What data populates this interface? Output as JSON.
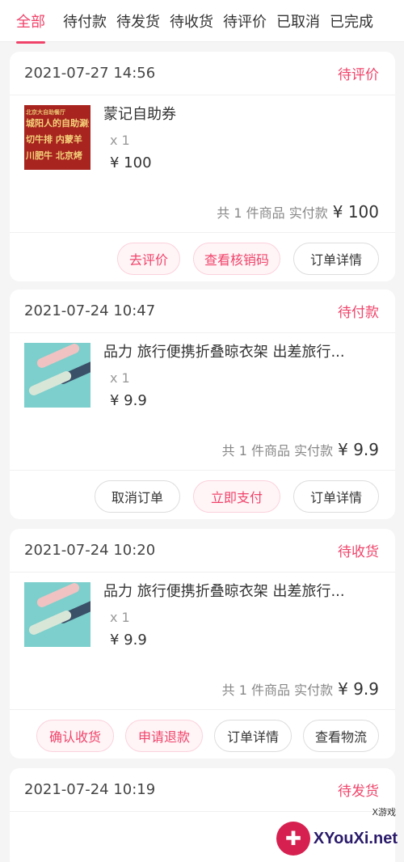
{
  "tabs": [
    {
      "label": "全部",
      "active": true
    },
    {
      "label": "待付款"
    },
    {
      "label": "待发货"
    },
    {
      "label": "待收货"
    },
    {
      "label": "待评价"
    },
    {
      "label": "已取消"
    },
    {
      "label": "已完成"
    }
  ],
  "orders": [
    {
      "time": "2021-07-27 14:56",
      "status": "待评价",
      "item": {
        "name": "蒙记自助券",
        "qty": "x 1",
        "price": "¥ 100",
        "thumb_lines": [
          "北京大自助餐厅",
          "城阳人的自助涮烤",
          "切牛排 内蒙羊",
          "川肥牛 北京烤"
        ]
      },
      "summary_label": "共 1 件商品 实付款",
      "total": "¥ 100",
      "buttons": [
        {
          "label": "去评价",
          "style": "pink"
        },
        {
          "label": "查看核销码",
          "style": "pink"
        },
        {
          "label": "订单详情",
          "style": "plain"
        }
      ]
    },
    {
      "time": "2021-07-24 10:47",
      "status": "待付款",
      "item": {
        "name": "品力 旅行便携折叠晾衣架 出差旅行...",
        "qty": "x 1",
        "price": "¥ 9.9"
      },
      "summary_label": "共 1 件商品 实付款",
      "total": "¥ 9.9",
      "buttons": [
        {
          "label": "取消订单",
          "style": "plain"
        },
        {
          "label": "立即支付",
          "style": "pink"
        },
        {
          "label": "订单详情",
          "style": "plain"
        }
      ]
    },
    {
      "time": "2021-07-24 10:20",
      "status": "待收货",
      "item": {
        "name": "品力 旅行便携折叠晾衣架 出差旅行...",
        "qty": "x 1",
        "price": "¥ 9.9"
      },
      "summary_label": "共 1 件商品 实付款",
      "total": "¥ 9.9",
      "buttons": [
        {
          "label": "确认收货",
          "style": "pink"
        },
        {
          "label": "申请退款",
          "style": "pink"
        },
        {
          "label": "订单详情",
          "style": "plain"
        },
        {
          "label": "查看物流",
          "style": "plain"
        }
      ]
    },
    {
      "time": "2021-07-24 10:19",
      "status": "待发货"
    }
  ],
  "watermark": {
    "brand": "XYouXi.net",
    "sub": "X游戏"
  },
  "colors": {
    "accent": "#f0436a",
    "background": "#f5f5f5"
  }
}
